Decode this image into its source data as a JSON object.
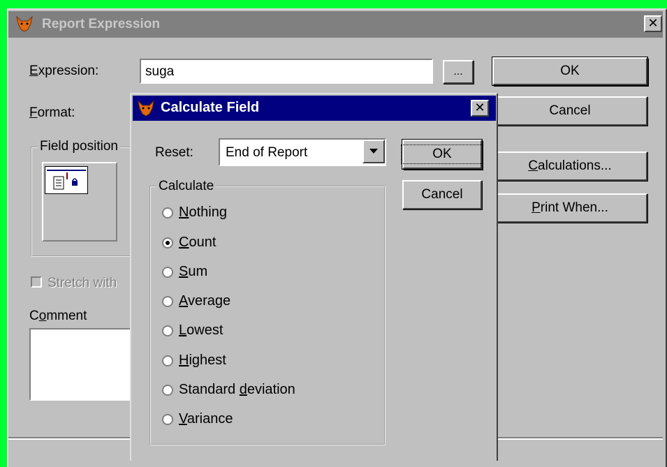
{
  "main_dialog": {
    "title": "Report Expression",
    "close_glyph": "✕",
    "expression_label": "Expression:",
    "expression_value": "suga",
    "browse_label": "...",
    "format_label": "Format:",
    "field_position_label": "Field position",
    "stretch_label": "Stretch with",
    "comment_label": "Comment",
    "ok_label": "OK",
    "cancel_label": "Cancel",
    "calculations_label": "Calculations...",
    "print_when_label": "Print When..."
  },
  "calc_dialog": {
    "title": "Calculate Field",
    "close_glyph": "✕",
    "reset_label": "Reset:",
    "reset_value": "End of Report",
    "calculate_label": "Calculate",
    "ok_label": "OK",
    "cancel_label": "Cancel",
    "options": [
      {
        "pre": "",
        "ul": "N",
        "post": "othing",
        "checked": false
      },
      {
        "pre": "",
        "ul": "C",
        "post": "ount",
        "checked": true
      },
      {
        "pre": "",
        "ul": "S",
        "post": "um",
        "checked": false
      },
      {
        "pre": "",
        "ul": "A",
        "post": "verage",
        "checked": false
      },
      {
        "pre": "",
        "ul": "L",
        "post": "owest",
        "checked": false
      },
      {
        "pre": "",
        "ul": "H",
        "post": "ighest",
        "checked": false
      },
      {
        "pre": "Standard ",
        "ul": "d",
        "post": "eviation",
        "checked": false
      },
      {
        "pre": "",
        "ul": "V",
        "post": "ariance",
        "checked": false
      }
    ]
  },
  "colors": {
    "desktop": "#00ff33",
    "active_title": "#000080",
    "inactive_title": "#808080",
    "face": "#c0c0c0"
  },
  "icons": [
    "fox-app-icon",
    "close-icon",
    "field-position-icon",
    "dropdown-arrow-icon"
  ]
}
